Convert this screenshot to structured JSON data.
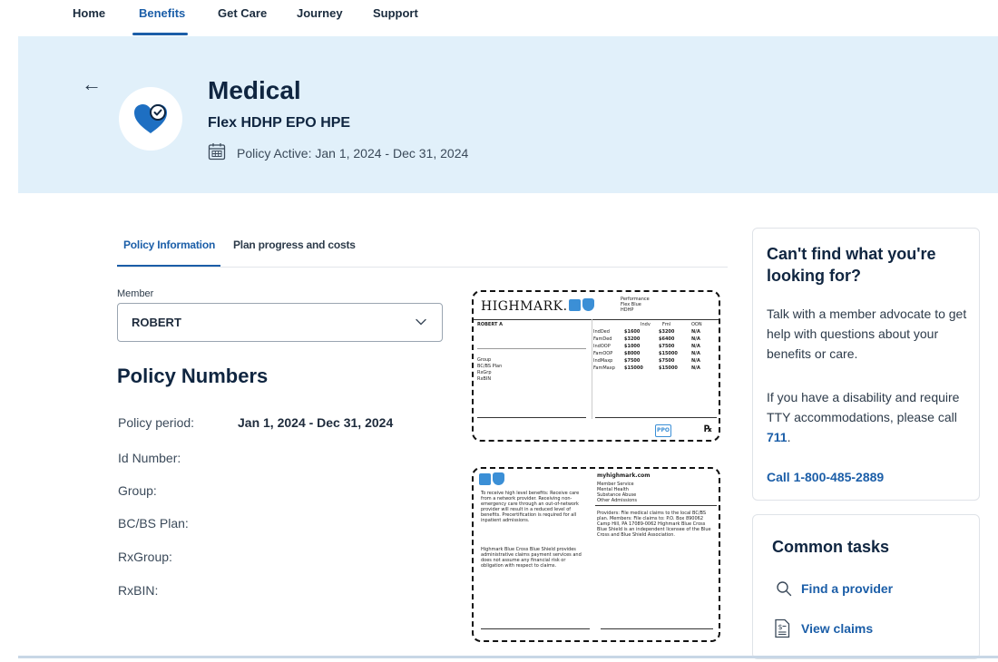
{
  "nav": {
    "items": [
      {
        "label": "Home"
      },
      {
        "label": "Benefits"
      },
      {
        "label": "Get Care"
      },
      {
        "label": "Journey"
      },
      {
        "label": "Support"
      }
    ],
    "active": "Benefits"
  },
  "hero": {
    "title": "Medical",
    "subtitle": "Flex HDHP EPO HPE",
    "policy_active": "Policy Active: Jan 1, 2024 - Dec 31, 2024"
  },
  "tabs": [
    {
      "label": "Policy Information"
    },
    {
      "label": "Plan progress and costs"
    }
  ],
  "member": {
    "label": "Member",
    "value": "ROBERT"
  },
  "policy": {
    "heading": "Policy Numbers",
    "rows": [
      {
        "label": "Policy period:",
        "value": "Jan 1, 2024 - Dec 31, 2024"
      },
      {
        "label": "Id Number:",
        "value": ""
      },
      {
        "label": "Group:",
        "value": ""
      },
      {
        "label": "BC/BS Plan:",
        "value": ""
      },
      {
        "label": "RxGroup:",
        "value": ""
      },
      {
        "label": "RxBIN:",
        "value": ""
      }
    ]
  },
  "card_front": {
    "logo": "HIGHMARK.",
    "plan_lines": [
      "Performance",
      "Flex Blue",
      "HDHP"
    ],
    "member_name": "ROBERT A",
    "left_labels": [
      "Group",
      "BC/BS Plan",
      "RxGrp",
      "RxBIN"
    ],
    "cost_headers": [
      "Indv",
      "Fml",
      "OON"
    ],
    "cost_rows": [
      {
        "label": "IndDed",
        "a": "$1600",
        "b": "$3200",
        "c": "N/A"
      },
      {
        "label": "FamDed",
        "a": "$3200",
        "b": "$6400",
        "c": "N/A"
      },
      {
        "label": "IndOOP",
        "a": "$1000",
        "b": "$7500",
        "c": "N/A"
      },
      {
        "label": "FamOOP",
        "a": "$8000",
        "b": "$15000",
        "c": "N/A"
      },
      {
        "label": "IndMaxp",
        "a": "$7500",
        "b": "$7500",
        "c": "N/A"
      },
      {
        "label": "FamMaxp",
        "a": "$15000",
        "b": "$15000",
        "c": "N/A"
      }
    ],
    "ppo": "PPO",
    "rx": "℞"
  },
  "card_back": {
    "site": "myhighmark.com",
    "service_lines": [
      "Member Service",
      "Mental Health",
      "Substance Abuse",
      "Other Admissions"
    ],
    "left_para1": "To receive high level benefits: Receive care from a network provider. Receiving non-emergency care through an out-of-network provider will result in a reduced level of benefits. Precertification is required for all inpatient admissions.",
    "left_para2": "Highmark Blue Cross Blue Shield provides administrative claims payment services and does not assume any financial risk or obligation with respect to claims.",
    "right_para": "Providers: File medical claims to the local BC/BS plan. Members: File claims to: P.O. Box 890062 Camp Hill, PA 17089-0062 Highmark Blue Cross Blue Shield is an independent licensee of the Blue Cross and Blue Shield Association."
  },
  "help": {
    "title": "Can't find what you're looking for?",
    "text1": "Talk with a member advocate to get help with questions about your benefits or care.",
    "text2": "If you have a disability and require TTY accommodations, please call",
    "tty_number": "711",
    "tty_suffix": ".",
    "call_label": "Call 1-800-485-2889"
  },
  "tasks": {
    "title": "Common tasks",
    "items": [
      {
        "label": "Find a provider",
        "icon": "search-icon"
      },
      {
        "label": "View claims",
        "icon": "claims-icon"
      }
    ]
  },
  "colors": {
    "accent": "#1b5ea8",
    "hero_bg": "#e1f0fa",
    "heart": "#1e6fc2"
  }
}
